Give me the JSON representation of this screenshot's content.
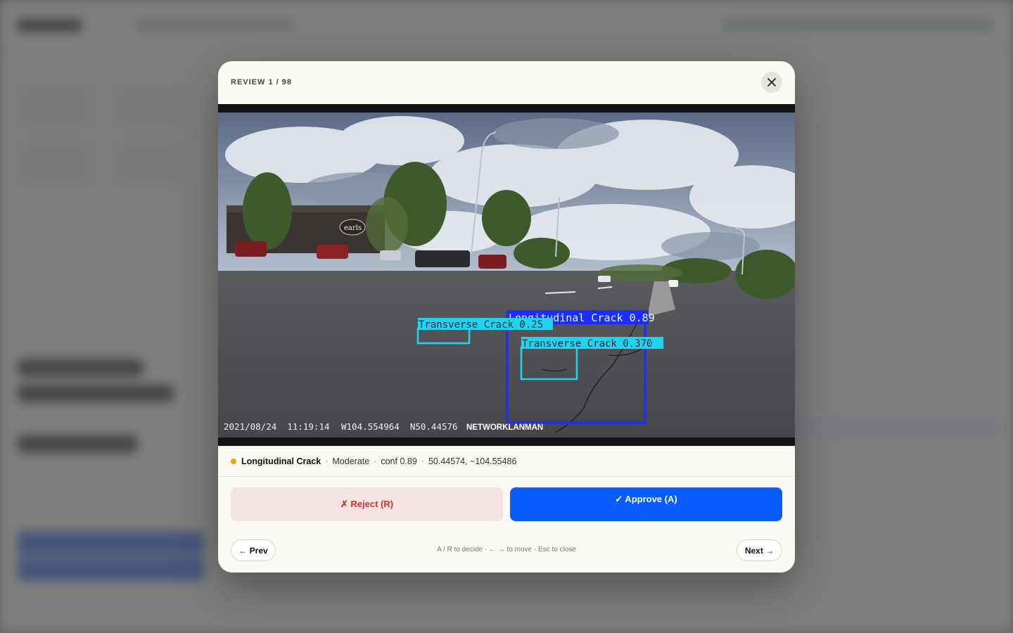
{
  "modal": {
    "counter": "REVIEW 1 / 98",
    "close_icon": "close-icon"
  },
  "image": {
    "timestamp": "2021/08/24  11:19:14",
    "gps": "W104.554964  N50.44576",
    "watermark": "NETWORKLANMAN",
    "sign_text": "earls",
    "detections": [
      {
        "label": "Longitudinal Crack 0.89",
        "color": "#1a2cff"
      },
      {
        "label": "Transverse Crack 0.25",
        "color": "#22d3ee"
      },
      {
        "label": "Transverse Crack 0.370",
        "color": "#22d3ee"
      }
    ]
  },
  "meta": {
    "type": "Longitudinal Crack",
    "severity": "Moderate",
    "confidence": "conf 0.89",
    "coords": "50.44574, −104.55486",
    "dot_color": "#e8a400"
  },
  "actions": {
    "reject_label": "✗ Reject (R)",
    "approve_label": "✓ Approve (A)",
    "prev_label": "← Prev",
    "next_label": "Next →",
    "hint": "A / R to decide · ← → to move · Esc to close"
  }
}
